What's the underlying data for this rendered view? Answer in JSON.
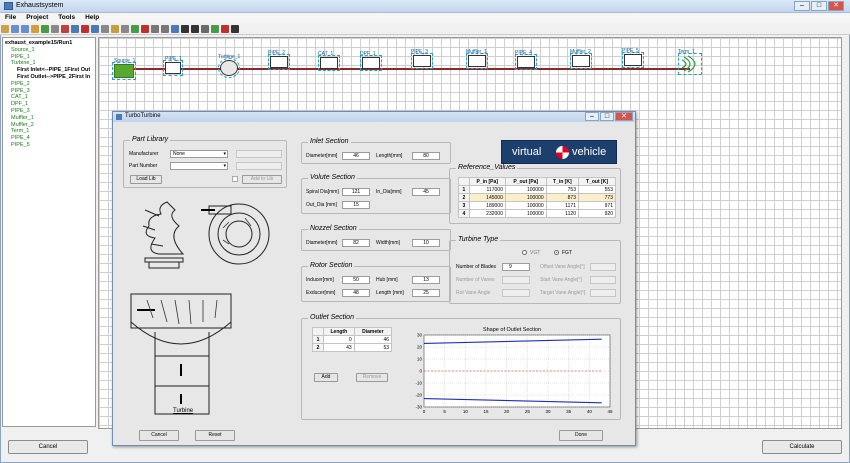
{
  "app": {
    "title": "Exhaustsystem"
  },
  "menu": [
    "File",
    "Project",
    "Tools",
    "Help"
  ],
  "tree": {
    "items": [
      {
        "label": "exhaust_example15/Run1",
        "style": "b"
      },
      {
        "label": "Source_1",
        "style": "g"
      },
      {
        "label": "PIPE_1",
        "style": "g"
      },
      {
        "label": "Turbine_1",
        "style": "g"
      },
      {
        "label": "First Inlet<--PIPE_1First Out",
        "style": "b"
      },
      {
        "label": "First Outlet-->PIPE_2First In",
        "style": "b"
      },
      {
        "label": "PIPE_2",
        "style": "g"
      },
      {
        "label": "PIPE_3",
        "style": "g"
      },
      {
        "label": "CAT_1",
        "style": "g"
      },
      {
        "label": "DPF_1",
        "style": "g"
      },
      {
        "label": "PIPE_3",
        "style": "g"
      },
      {
        "label": "Muffler_1",
        "style": "g"
      },
      {
        "label": "Muffler_2",
        "style": "g"
      },
      {
        "label": "Term_1",
        "style": "g"
      },
      {
        "label": "PIPE_4",
        "style": "g"
      },
      {
        "label": "PIPE_5",
        "style": "g"
      }
    ]
  },
  "canvas": {
    "nodes": [
      "Source_1",
      "PIPE_1",
      "Turbine_1",
      "PIPE_2",
      "CAT_1",
      "DPF_1",
      "PIPE_3",
      "Muffler_1",
      "PIPE_4",
      "Muffler_2",
      "PIPE_5",
      "Term_1"
    ]
  },
  "bottom": {
    "cancel": "Cancel",
    "calculate": "Calculate"
  },
  "dialog": {
    "title": "TurboTurbine",
    "logo": {
      "left": "virtual",
      "right": "vehicle"
    },
    "part_library": {
      "title": "Part Library",
      "manufacturer_label": "Manufacturer",
      "manufacturer_value": "None",
      "part_number_label": "Part Number",
      "load_lib": "Load Lib",
      "add_to_lib": "Add to Lib"
    },
    "inlet": {
      "title": "Inlet Section",
      "diameter_label": "Diameter[mm]",
      "diameter_value": "46",
      "length_label": "Length[mm]",
      "length_value": "80"
    },
    "volute": {
      "title": "Volute Section",
      "spiral_label": "Spiral Dia[mm]",
      "spiral_value": "121",
      "india_label": "In_Dia[mm]",
      "india_value": "45",
      "outdia_label": "Out_Dia [mm]",
      "outdia_value": "15"
    },
    "nozzel": {
      "title": "Nozzel Section",
      "diameter_label": "Diameter[mm]",
      "diameter_value": "82",
      "width_label": "Width[mm]",
      "width_value": "10"
    },
    "rotor": {
      "title": "Rotor Section",
      "inducer_label": "Inducer[mm]",
      "inducer_value": "50",
      "hub_label": "Hub [mm]",
      "hub_value": "13",
      "exducer_label": "Exducer[mm]",
      "exducer_value": "48",
      "length_label": "Length [mm]",
      "length_value": "25"
    },
    "turbine_caption": "Turbine",
    "reference": {
      "title": "Reference_Values",
      "headers": [
        "",
        "P_in [Pa]",
        "P_out [Pa]",
        "T_in [K]",
        "T_out [K]"
      ],
      "rows": [
        [
          "1",
          "117000",
          "100000",
          "753",
          "553"
        ],
        [
          "2",
          "145000",
          "100000",
          "873",
          "773"
        ],
        [
          "3",
          "189000",
          "100000",
          "1171",
          "971"
        ],
        [
          "4",
          "232000",
          "100000",
          "1120",
          "920"
        ]
      ]
    },
    "turbine_type": {
      "title": "Turbine Type",
      "vgt": "VGT",
      "fgt": "FGT",
      "blades_label": "Number of Blades",
      "blades_value": "9",
      "offset_label": "Offset Vane Angle[°]",
      "vanes_label": "Number of Vanes",
      "start_vane_label": "Start Vane Angle[°]",
      "rot_vane_label": "Rot Vane Angle",
      "target_vane_label": "Target Vane Angle[°]"
    },
    "outlet": {
      "title": "Outlet Section",
      "headers": [
        "",
        "Length",
        "Diameter"
      ],
      "rows": [
        [
          "1",
          "0",
          "46"
        ],
        [
          "2",
          "43",
          "53"
        ]
      ],
      "add": "Add",
      "remove": "Remove"
    },
    "buttons": {
      "cancel": "Cancel",
      "reset": "Reset",
      "done": "Done"
    }
  },
  "chart_data": {
    "type": "line",
    "title": "Shape of Outlet Section",
    "xlim": [
      0,
      45
    ],
    "ylim": [
      -30,
      30
    ],
    "xticks": [
      "0",
      "5",
      "10",
      "15",
      "20",
      "25",
      "30",
      "35",
      "40",
      "45"
    ],
    "yticks": [
      "30",
      "20",
      "10",
      "0",
      "-10",
      "-20",
      "-30"
    ],
    "grid": true,
    "series": [
      {
        "x": [
          0,
          43
        ],
        "y": [
          23,
          26.5
        ],
        "color": "#1b2fbf",
        "style": "solid"
      },
      {
        "x": [
          0,
          43
        ],
        "y": [
          -23,
          -26.5
        ],
        "color": "#1b2fbf",
        "style": "solid"
      },
      {
        "x": [
          0,
          43
        ],
        "y": [
          0,
          0
        ],
        "color": "#cc2222",
        "style": "dashed"
      }
    ]
  }
}
